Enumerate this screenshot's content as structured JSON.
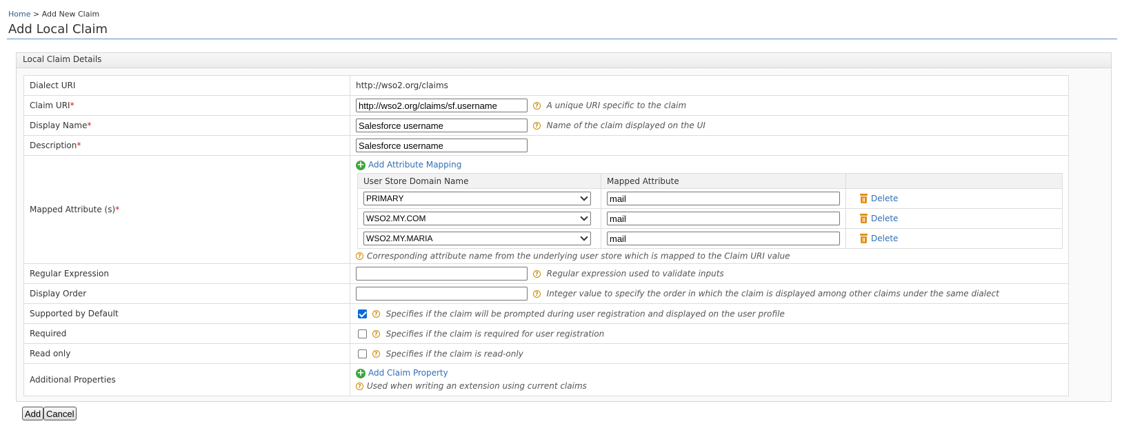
{
  "breadcrumb": {
    "home": "Home",
    "separator": " > ",
    "current": "Add New Claim"
  },
  "page_title": "Add Local Claim",
  "panel_title": "Local Claim Details",
  "required_marker": "*",
  "fields": {
    "dialect_uri": {
      "label": "Dialect URI",
      "value": "http://wso2.org/claims"
    },
    "claim_uri": {
      "label": "Claim URI",
      "value": "http://wso2.org/claims/sf.username",
      "hint": "A unique URI specific to the claim"
    },
    "display_name": {
      "label": "Display Name",
      "value": "Salesforce username",
      "hint": "Name of the claim displayed on the UI"
    },
    "description": {
      "label": "Description",
      "value": "Salesforce username"
    },
    "mapped_attributes": {
      "label": "Mapped Attribute (s)",
      "add_link": "Add Attribute Mapping",
      "col_domain": "User Store Domain Name",
      "col_attribute": "Mapped Attribute",
      "delete_label": "Delete",
      "hint": "Corresponding attribute name from the underlying user store which is mapped to the Claim URI value",
      "rows": [
        {
          "domain": "PRIMARY",
          "attribute": "mail"
        },
        {
          "domain": "WSO2.MY.COM",
          "attribute": "mail"
        },
        {
          "domain": "WSO2.MY.MARIA",
          "attribute": "mail"
        }
      ]
    },
    "regex": {
      "label": "Regular Expression",
      "value": "",
      "hint": "Regular expression used to validate inputs"
    },
    "display_order": {
      "label": "Display Order",
      "value": "",
      "hint": "Integer value to specify the order in which the claim is displayed among other claims under the same dialect"
    },
    "supported": {
      "label": "Supported by Default",
      "checked": true,
      "hint": "Specifies if the claim will be prompted during user registration and displayed on the user profile"
    },
    "required": {
      "label": "Required",
      "checked": false,
      "hint": "Specifies if the claim is required for user registration"
    },
    "read_only": {
      "label": "Read only",
      "checked": false,
      "hint": "Specifies if the claim is read-only"
    },
    "additional": {
      "label": "Additional Properties",
      "add_link": "Add Claim Property",
      "hint": "Used when writing an extension using current claims"
    }
  },
  "buttons": {
    "add": "Add",
    "cancel": "Cancel"
  },
  "colors": {
    "link": "#2f6fb5",
    "required": "#dd1111",
    "add_icon": "#3da93d",
    "help_icon": "#c88a00",
    "trash_icon": "#e0901a",
    "checkbox_checked": "#0a6ad9",
    "title_rule": "#5a8cc0"
  },
  "icons": {
    "help": "help-icon",
    "add": "plus-circle-icon",
    "delete": "trash-icon",
    "dropdown": "chevron-down-icon"
  }
}
